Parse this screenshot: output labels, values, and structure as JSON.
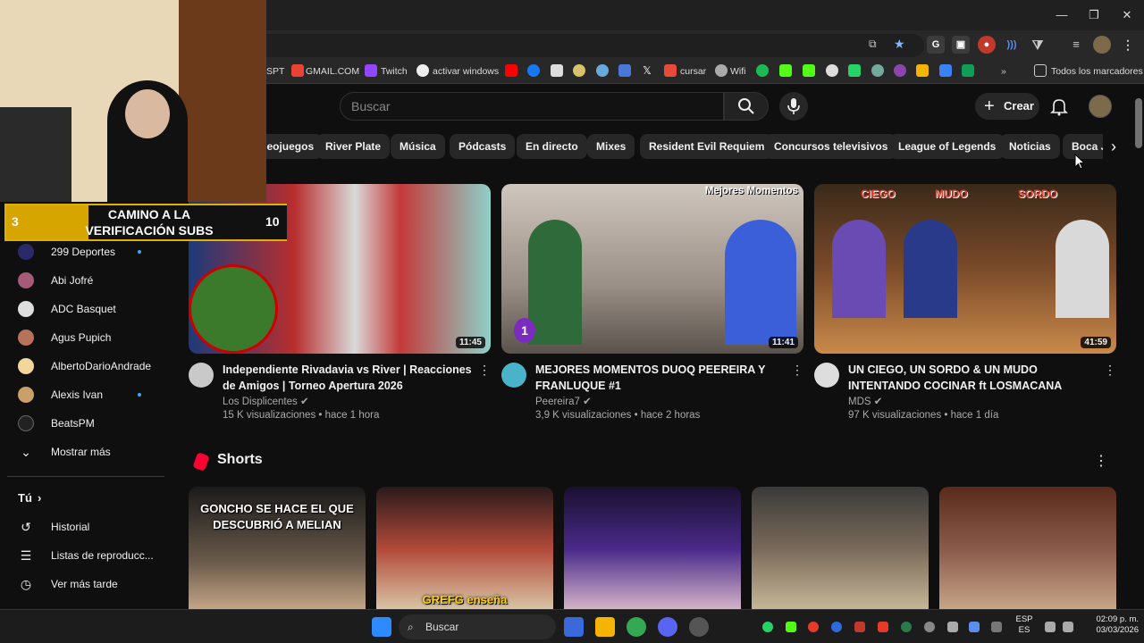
{
  "bookmarks": [
    "SPT",
    "GMAIL.COM",
    "Twitch",
    "activar windows",
    "cursar",
    "Wifi",
    "Todos los marcadores"
  ],
  "search": {
    "placeholder": "Buscar"
  },
  "header": {
    "create_label": "Crear"
  },
  "chips": [
    "Videojuegos",
    "River Plate",
    "Música",
    "Pódcasts",
    "En directo",
    "Mixes",
    "Resident Evil Requiem",
    "Concursos televisivos",
    "League of Legends",
    "Noticias",
    "Boca Juniors"
  ],
  "overlay": {
    "left_num": "3",
    "text_line1": "CAMINO A LA",
    "text_line2": "VERIFICACIÓN SUBS",
    "right_num": "10",
    "progress": 0.3
  },
  "sidebar": {
    "subscriptions": [
      {
        "name": "299 Deportes",
        "new": true,
        "color": "#2a2a6a"
      },
      {
        "name": "Abi Jofré",
        "new": false,
        "color": "#a55a7a"
      },
      {
        "name": "ADC Basquet",
        "new": false,
        "color": "#ddd"
      },
      {
        "name": "Agus Pupich",
        "new": false,
        "color": "#b7725a"
      },
      {
        "name": "AlbertoDarioAndrade",
        "new": false,
        "color": "#f2d79a"
      },
      {
        "name": "Alexis Ivan",
        "new": true,
        "color": "#c9a06a"
      },
      {
        "name": "BeatsPM",
        "new": false,
        "color": "#222"
      }
    ],
    "show_more": "Mostrar más",
    "you_label": "Tú",
    "you_items": [
      "Historial",
      "Listas de reproducc...",
      "Ver más tarde"
    ]
  },
  "videos": [
    {
      "title": "Independiente Rivadavia vs River | Reacciones de Amigos | Torneo Apertura 2026",
      "channel": "Los Displicentes",
      "views": "15 K visualizaciones",
      "age": "hace 1 hora",
      "duration": "11:45",
      "verified": true
    },
    {
      "title": "MEJORES MOMENTOS DUOQ PEEREIRA Y FRANLUQUE #1",
      "channel": "Peereira7",
      "views": "3,9 K visualizaciones",
      "age": "hace 2 horas",
      "duration": "11:41",
      "verified": true,
      "thumb_text": "Mejores Momentos",
      "badge": "1"
    },
    {
      "title": "UN CIEGO, UN SORDO & UN MUDO INTENTANDO COCINAR ft LOSMACANA",
      "channel": "MDS",
      "views": "97 K visualizaciones",
      "age": "hace 1 día",
      "duration": "41:59",
      "verified": true,
      "thumb_labels": [
        "CIEGO",
        "MUDO",
        "SORDO"
      ]
    }
  ],
  "shorts": {
    "title": "Shorts",
    "items": [
      {
        "caption": "GONCHO SE HACE EL QUE DESCUBRIÓ A MELIAN"
      },
      {
        "caption": "GREFG enseña"
      },
      {
        "caption": ""
      },
      {
        "caption": ""
      },
      {
        "caption": ""
      }
    ]
  },
  "taskbar": {
    "search_placeholder": "Buscar",
    "lang": "ESP",
    "lang_sub": "ES",
    "time": "02:09 p. m.",
    "date": "03/03/2026"
  },
  "colors": {
    "bg": "#0f0f0f",
    "chip": "#272727",
    "accent_red": "#ff0000",
    "new_dot": "#3ea6ff"
  }
}
